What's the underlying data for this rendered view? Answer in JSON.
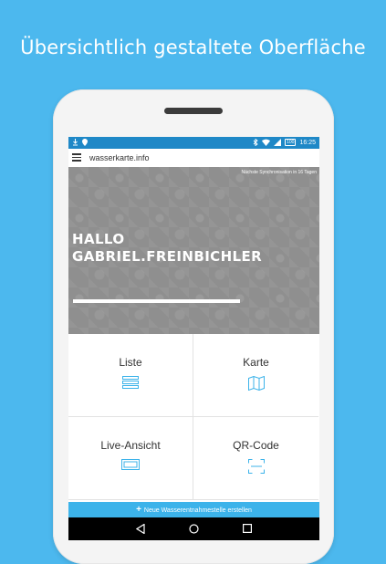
{
  "headline": "Übersichtlich gestaltete Oberfläche",
  "status_bar": {
    "time": "16:25",
    "battery": "100"
  },
  "app_bar": {
    "title": "wasserkarte.info"
  },
  "hero": {
    "sync_note": "Nächste Synchronisation in 16 Tagen",
    "greeting_line1": "HALLO",
    "greeting_line2": "GABRIEL.FREINBICHLER"
  },
  "tiles": [
    {
      "label": "Liste",
      "icon": "list-icon"
    },
    {
      "label": "Karte",
      "icon": "map-icon"
    },
    {
      "label": "Live-Ansicht",
      "icon": "camera-icon"
    },
    {
      "label": "QR-Code",
      "icon": "qr-scan-icon"
    }
  ],
  "add_bar": {
    "label": "Neue Wasserentnahmestelle erstellen"
  },
  "colors": {
    "background": "#4cb8ee",
    "status_bar": "#1f88c7",
    "accent": "#3cb3ea",
    "hero": "#8f8f8f"
  }
}
